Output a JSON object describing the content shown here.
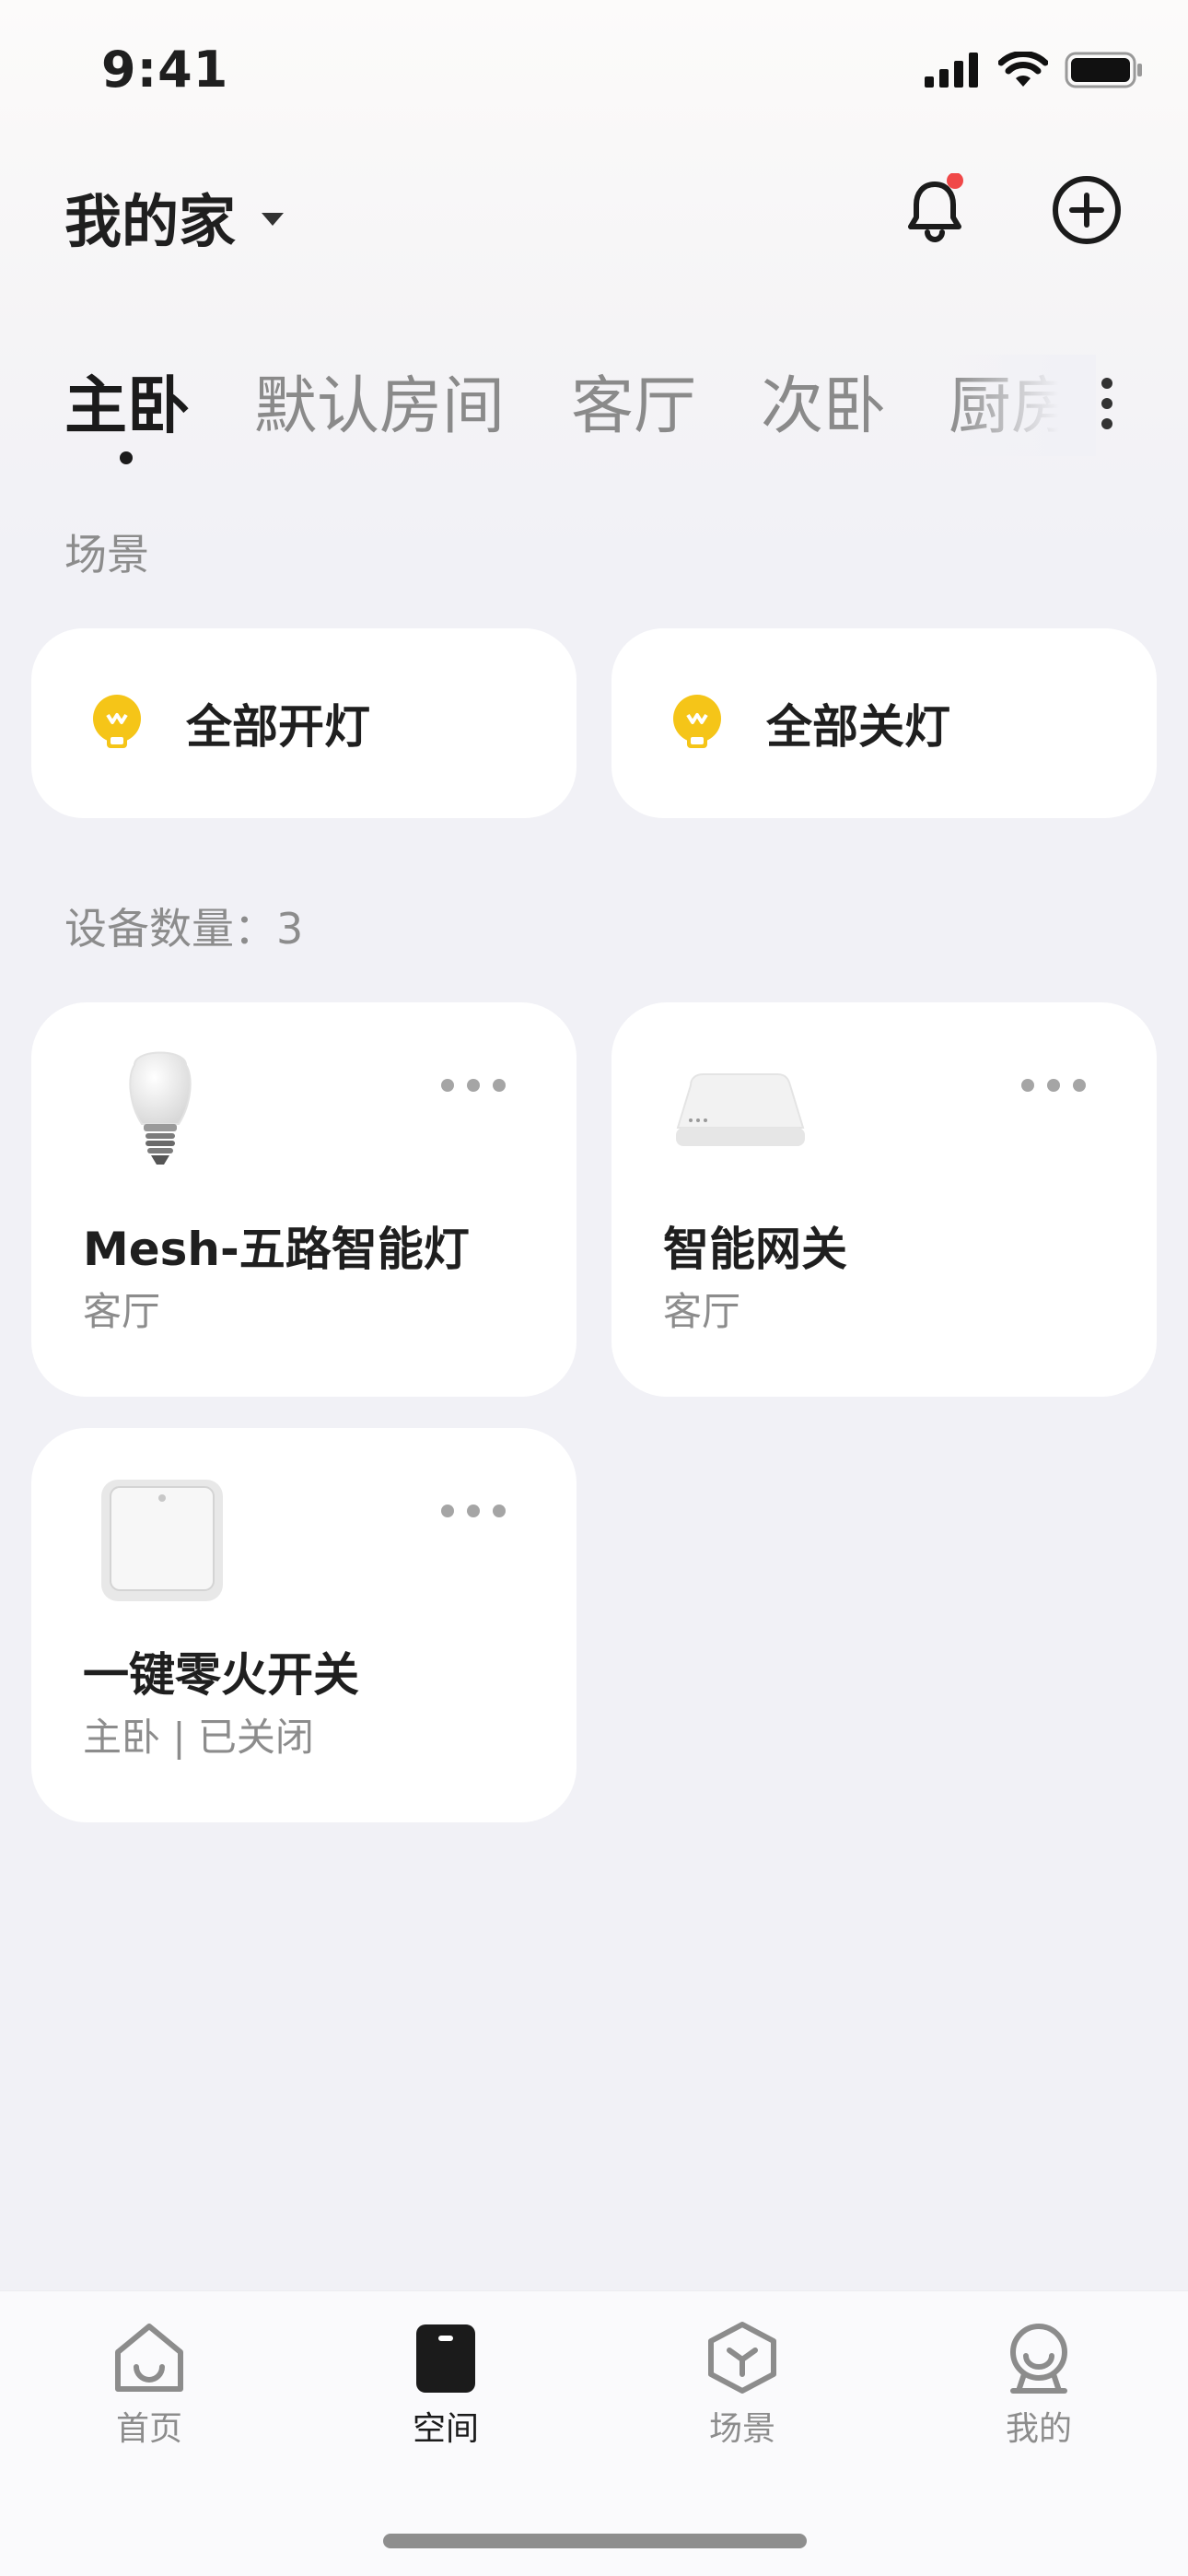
{
  "status_bar": {
    "time": "9:41"
  },
  "header": {
    "home_name": "我的家"
  },
  "tabs": [
    "主卧",
    "默认房间",
    "客厅",
    "次卧",
    "厨房"
  ],
  "sections": {
    "scenes_label": "场景",
    "device_count_label": "设备数量：3"
  },
  "scenes": [
    {
      "label": "全部开灯",
      "icon": "bulb-icon"
    },
    {
      "label": "全部关灯",
      "icon": "bulb-icon"
    }
  ],
  "devices": [
    {
      "name": "Mesh-五路智能灯",
      "sub": "客厅",
      "icon": "light-bulb-device"
    },
    {
      "name": "智能网关",
      "sub": "客厅",
      "icon": "gateway-device"
    },
    {
      "name": "一键零火开关",
      "sub": "主卧 | 已关闭",
      "icon": "wall-switch-device"
    }
  ],
  "bottom_nav": [
    {
      "label": "首页",
      "icon": "home-icon"
    },
    {
      "label": "空间",
      "icon": "space-icon"
    },
    {
      "label": "场景",
      "icon": "scene-icon"
    },
    {
      "label": "我的",
      "icon": "profile-icon"
    }
  ],
  "colors": {
    "accent_yellow": "#f5c518",
    "notification_dot": "#f04848",
    "active": "#1b1b1b",
    "inactive": "#8c8c8c"
  }
}
